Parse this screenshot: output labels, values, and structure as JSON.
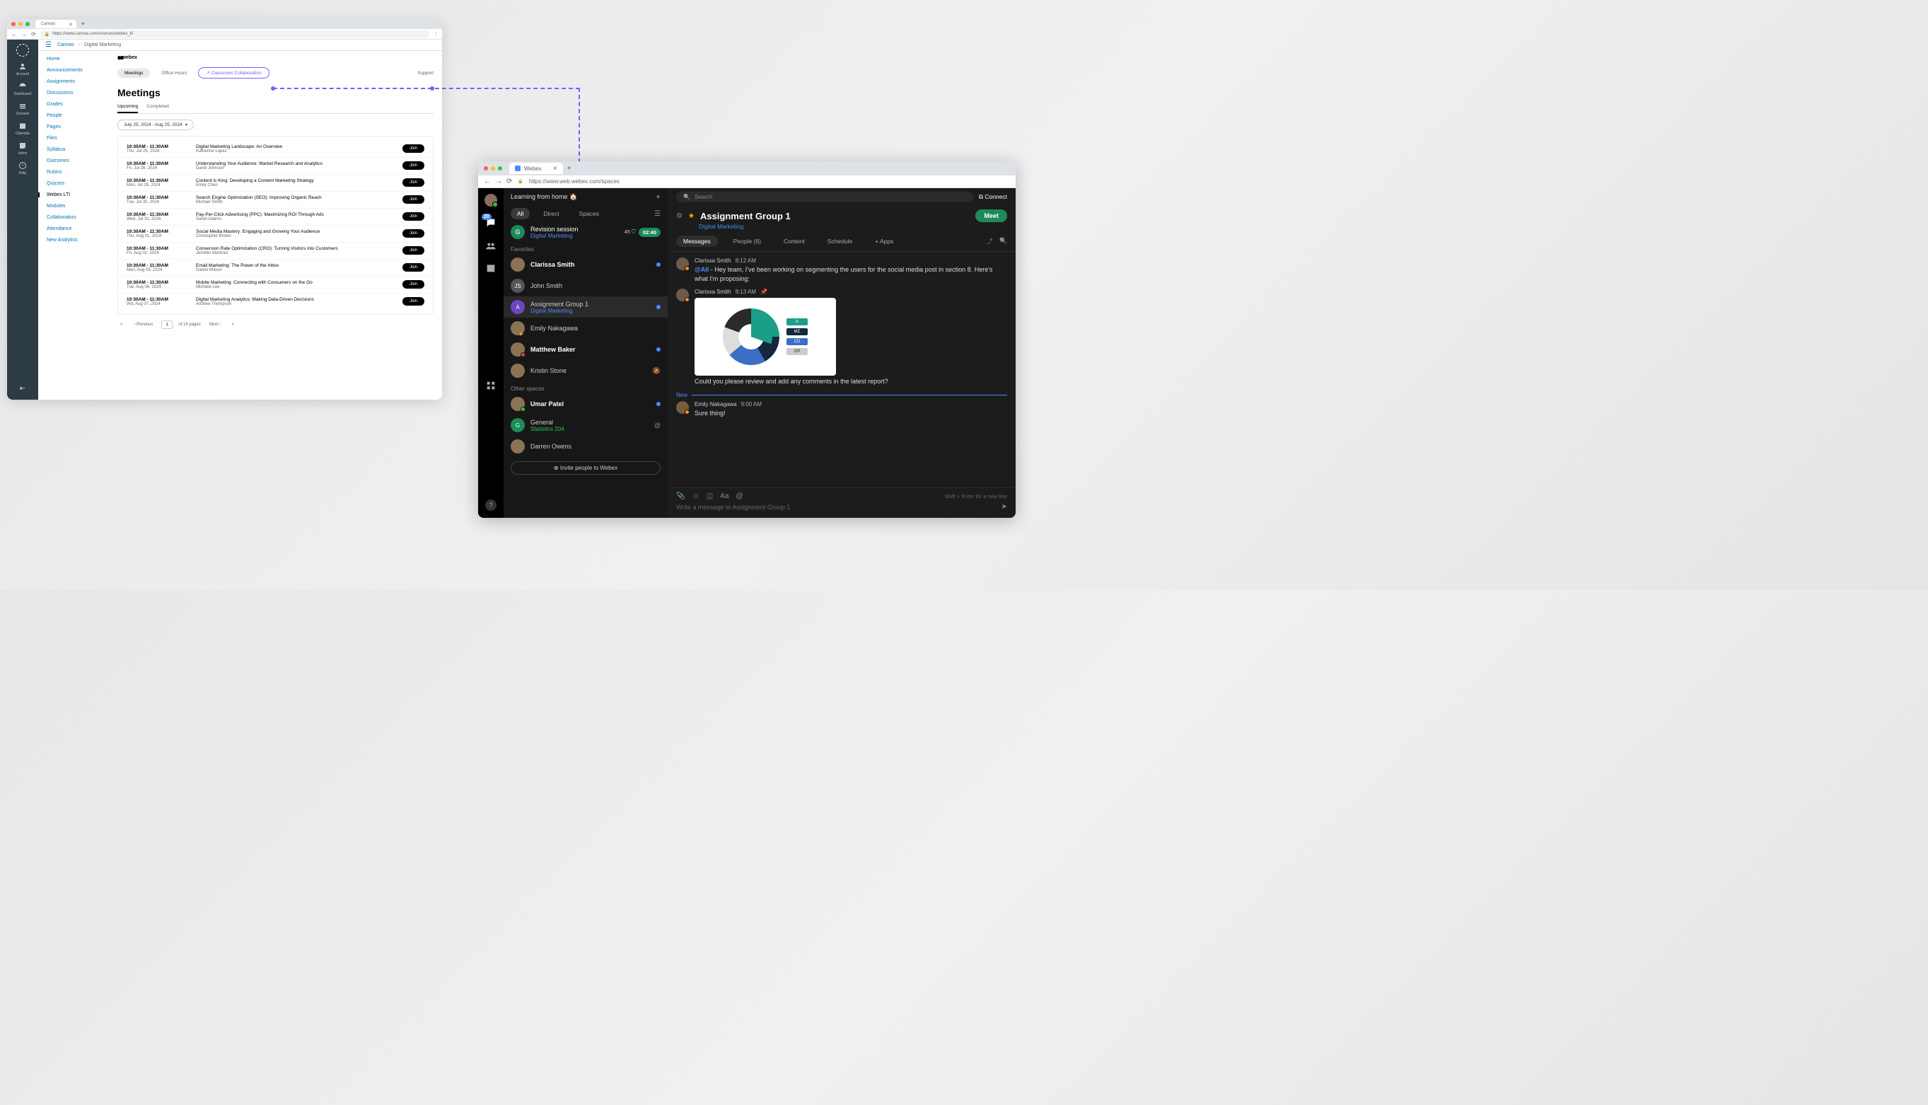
{
  "canvas": {
    "tab_title": "Canvas",
    "url": "https://www.canvas.com/courses/webex_lti",
    "breadcrumb": {
      "root": "Canvas",
      "course": "Digital Marketing"
    },
    "rail": [
      {
        "label": "Account"
      },
      {
        "label": "Dashboard"
      },
      {
        "label": "Courses"
      },
      {
        "label": "Calendar"
      },
      {
        "label": "Inbox"
      },
      {
        "label": "Help"
      }
    ],
    "course_nav": [
      "Home",
      "Announcements",
      "Assignments",
      "Discussions",
      "Grades",
      "People",
      "Pages",
      "Files",
      "Syllabus",
      "Outcomes",
      "Rubics",
      "Quizzes",
      "Webex LTI",
      "Modules",
      "Collaboration",
      "Attendance",
      "New Analytics"
    ],
    "course_nav_active": "Webex LTI",
    "brand": "webex",
    "pill_tabs": {
      "meetings": "Meetings",
      "office": "Office Hours",
      "classroom": "Classroom Collaboration",
      "support": "Support"
    },
    "heading": "Meetings",
    "subtabs": {
      "upcoming": "Upcoming",
      "completed": "Completed"
    },
    "daterange": "July 25, 2024 - Aug 25, 2024",
    "meetings": [
      {
        "time": "10:30AM - 11:30AM",
        "date": "Thu, Jul 25, 2024",
        "title": "Digital Marketing Landscape: An Overview",
        "host": "Katherine Lopez"
      },
      {
        "time": "10:30AM - 11:30AM",
        "date": "Fri, Jul 26, 2024",
        "title": "Understanding Your Audience: Market Research and Analytics",
        "host": "David Johnson"
      },
      {
        "time": "10:30AM - 11:30AM",
        "date": "Mon, Jul 29, 2024",
        "title": "Content is King: Developing a Content Marketing Strategy",
        "host": "Emily Chen"
      },
      {
        "time": "10:30AM - 11:30AM",
        "date": "Tue, Jul 30, 2024",
        "title": "Search Engine Optimization (SEO): Improving Organic Reach",
        "host": "Michael Smith"
      },
      {
        "time": "10:30AM - 11:30AM",
        "date": "Wed, Jul 31, 2024",
        "title": "Pay-Per-Click Advertising (PPC): Maximizing ROI Through Ads",
        "host": "Sarah Adams"
      },
      {
        "time": "10:30AM - 11:30AM",
        "date": "Thu, Aug 01, 2024",
        "title": "Social Media Mastery: Engaging and Growing Your Audience",
        "host": "Christopher Brown"
      },
      {
        "time": "10:30AM - 11:30AM",
        "date": "Fri, Aug 02, 2024",
        "title": "Conversion Rate Optimization (CRO): Turning Visitors into Customers",
        "host": "Jennifer Martinez"
      },
      {
        "time": "10:30AM - 11:30AM",
        "date": "Mon, Aug 05, 2024",
        "title": "Email Marketing: The Power of the Inbox",
        "host": "Daniel Wilson"
      },
      {
        "time": "10:30AM - 11:30AM",
        "date": "Tue, Aug 06, 2024",
        "title": "Mobile Marketing: Connecting with Consumers on the Go",
        "host": "Michelle Lee"
      },
      {
        "time": "10:30AM - 11:30AM",
        "date": "Wd, Aug 07, 2024",
        "title": "Digital Marketing Analytics: Making Data-Driven Decisions",
        "host": "Andrew Thompson"
      }
    ],
    "join_label": "Join",
    "paginator": {
      "prev": "Previous",
      "next": "Next",
      "page": "1",
      "of": "of 19 pages"
    }
  },
  "webex": {
    "tab_title": "Webex",
    "url": "https://www.web.webex.com/spaces",
    "status": "Learning from home 🏠",
    "rail_badge": "20",
    "search_placeholder": "Search",
    "connect": "Connect",
    "filters": {
      "all": "All",
      "direct": "Direct",
      "spaces": "Spaces"
    },
    "pinned": {
      "initial": "G",
      "name": "Revision session",
      "sub": "Digital Marketing",
      "count": "45",
      "timer": "02:40"
    },
    "section_fav": "Favorites",
    "section_other": "Other spaces",
    "favorites": [
      {
        "name": "Clarissa Smith",
        "bold": true,
        "unread": true,
        "av": "img"
      },
      {
        "name": "John Smith",
        "initial": "JS"
      },
      {
        "name": "Assignment Group 1",
        "sub": "Digital Marketing",
        "initial": "A",
        "selected": true,
        "unread": true
      },
      {
        "name": "Emily Nakagawa",
        "av": "img",
        "presence": "play"
      },
      {
        "name": "Matthew Baker",
        "bold": true,
        "unread": true,
        "av": "img",
        "presence": "dnd"
      },
      {
        "name": "Kristin Stone",
        "av": "img",
        "muted": true
      }
    ],
    "others": [
      {
        "name": "Umar Patel",
        "bold": true,
        "unread": true,
        "av": "img",
        "presence": "active"
      },
      {
        "name": "General",
        "sub": "Statistics 204",
        "sub_green": true,
        "initial": "G",
        "mention": true
      },
      {
        "name": "Darren Owens",
        "av": "img"
      }
    ],
    "invite": "Invite people to Webex",
    "space": {
      "title": "Assignment Group 1",
      "subtitle": "Digital Marketing",
      "meet": "Meet",
      "tabs": {
        "messages": "Messages",
        "people": "People (6)",
        "content": "Content",
        "schedule": "Schedule",
        "apps": "+  Apps"
      }
    },
    "messages": [
      {
        "name": "Clarissa Smith",
        "time": "8:12 AM",
        "mention": "@All",
        "text": " - Hey team, I've been working on segmenting the users for the social media post in section 8. Here's what I'm proposing:"
      },
      {
        "name": "Clarissa Smith",
        "time": "8:13 AM",
        "pinned": true,
        "attachment": true,
        "followup": "Could you please review and add any comments in the latest report?"
      }
    ],
    "new_label": "New",
    "msg3": {
      "name": "Emily Nakagawa",
      "time": "9:00 AM",
      "text": "Sure thing!"
    },
    "compose": {
      "placeholder": "Write a message to Assignment Group 1",
      "hint": "Shift + Enter for a new line"
    },
    "chart_legend": [
      "A",
      "MZ",
      "CD",
      "OR"
    ]
  }
}
